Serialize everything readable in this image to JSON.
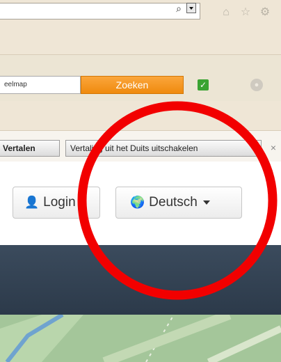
{
  "browser": {
    "address_search_glyph": "⌕",
    "icons": [
      "home-icon",
      "star-icon",
      "gear-icon"
    ]
  },
  "toolbar": {
    "search_value": "eelmap",
    "search_button": "Zoeken"
  },
  "translate_bar": {
    "translate_button": "Vertalen",
    "disable_button": "Vertaling uit het Duits uitschakelen",
    "close_glyph": "×"
  },
  "site_header": {
    "login_label": "Login",
    "language_label": "Deutsch"
  },
  "colors": {
    "search_button": "#f39317",
    "annotation": "#f20000",
    "dark_band": "#34424f",
    "map_green": "#a4c69a"
  }
}
